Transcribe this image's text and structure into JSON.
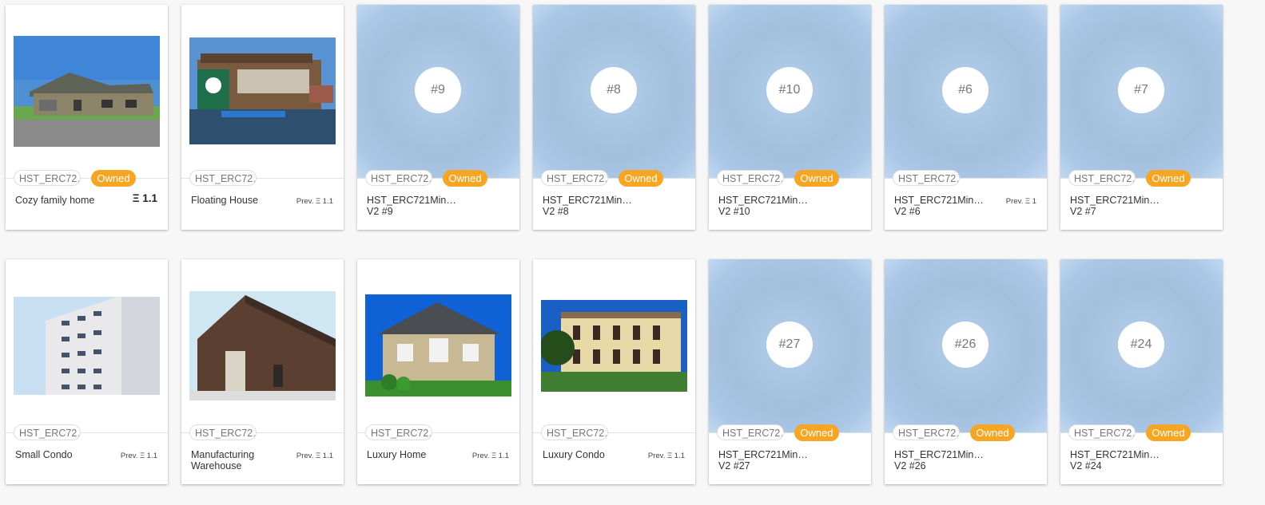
{
  "cards": [
    {
      "chip": "HST_ERC72…",
      "owned": "Owned",
      "name": "Cozy family home",
      "price": "Ξ 1.1"
    },
    {
      "chip": "HST_ERC72…",
      "name": "Floating House",
      "price": "Prev. Ξ 1.1"
    },
    {
      "chip": "HST_ERC72…",
      "owned": "Owned",
      "badge": "#9",
      "name_l1": "HST_ERC721Min…",
      "name_l2": "V2 #9"
    },
    {
      "chip": "HST_ERC72…",
      "owned": "Owned",
      "badge": "#8",
      "name_l1": "HST_ERC721Min…",
      "name_l2": "V2 #8"
    },
    {
      "chip": "HST_ERC72…",
      "owned": "Owned",
      "badge": "#10",
      "name_l1": "HST_ERC721Min…",
      "name_l2": "V2 #10"
    },
    {
      "chip": "HST_ERC72…",
      "badge": "#6",
      "name_l1": "HST_ERC721Min…",
      "name_l2": "V2 #6",
      "price": "Prev. Ξ 1"
    },
    {
      "chip": "HST_ERC72…",
      "owned": "Owned",
      "badge": "#7",
      "name_l1": "HST_ERC721Min…",
      "name_l2": "V2 #7"
    },
    {
      "chip": "HST_ERC72…",
      "name": "Small Condo",
      "price": "Prev. Ξ 1.1"
    },
    {
      "chip": "HST_ERC72…",
      "name_l1": "Manufacturing",
      "name_l2": "Warehouse",
      "price": "Prev. Ξ 1.1"
    },
    {
      "chip": "HST_ERC72…",
      "name": "Luxury Home",
      "price": "Prev. Ξ 1.1"
    },
    {
      "chip": "HST_ERC72…",
      "name": "Luxury Condo",
      "price": "Prev. Ξ 1.1"
    },
    {
      "chip": "HST_ERC72…",
      "owned": "Owned",
      "badge": "#27",
      "name_l1": "HST_ERC721Min…",
      "name_l2": "V2 #27"
    },
    {
      "chip": "HST_ERC72…",
      "owned": "Owned",
      "badge": "#26",
      "name_l1": "HST_ERC721Min…",
      "name_l2": "V2 #26"
    },
    {
      "chip": "HST_ERC72…",
      "owned": "Owned",
      "badge": "#24",
      "name_l1": "HST_ERC721Min…",
      "name_l2": "V2 #24"
    }
  ],
  "colors": {
    "owned": "#f6a623",
    "chip_border": "#dedede",
    "placeholder": "#a9c6e3"
  }
}
